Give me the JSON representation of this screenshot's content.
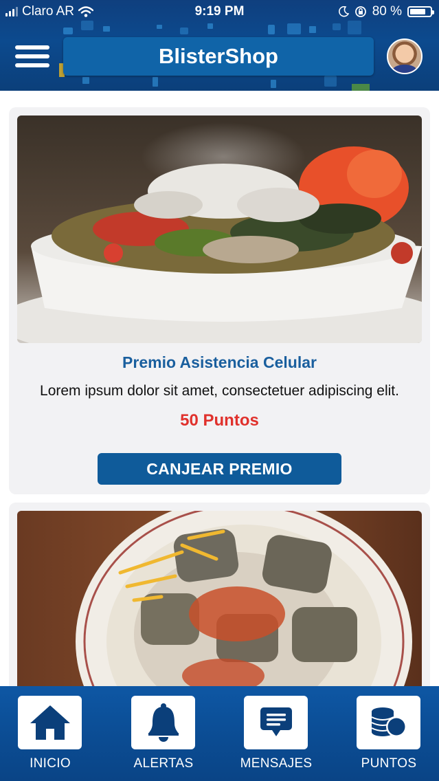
{
  "status_bar": {
    "carrier": "Claro AR",
    "time": "9:19 PM",
    "battery_percent": "80 %",
    "battery_level": 0.8
  },
  "header": {
    "title": "BlisterShop",
    "menu_icon": "hamburger-icon",
    "avatar": "user-avatar"
  },
  "cards": [
    {
      "title": "Premio Asistencia Celular",
      "description": "Lorem ipsum dolor sit amet, consectetuer adipiscing elit.",
      "points": "50 Puntos",
      "button": "CANJEAR PREMIO"
    }
  ],
  "bottom_nav": [
    {
      "label": "INICIO",
      "icon": "home-icon"
    },
    {
      "label": "ALERTAS",
      "icon": "bell-icon"
    },
    {
      "label": "MENSAJES",
      "icon": "message-icon"
    },
    {
      "label": "PUNTOS",
      "icon": "coins-icon"
    }
  ],
  "colors": {
    "header_bg": "#0c4a8e",
    "title_box": "#1064a8",
    "card_bg": "#f2f2f4",
    "prize_title": "#1a5f9e",
    "points": "#e0312c",
    "button_bg": "#0f5b9a",
    "nav_bg": "#0b4c93",
    "nav_icon": "#0b3f7a"
  }
}
